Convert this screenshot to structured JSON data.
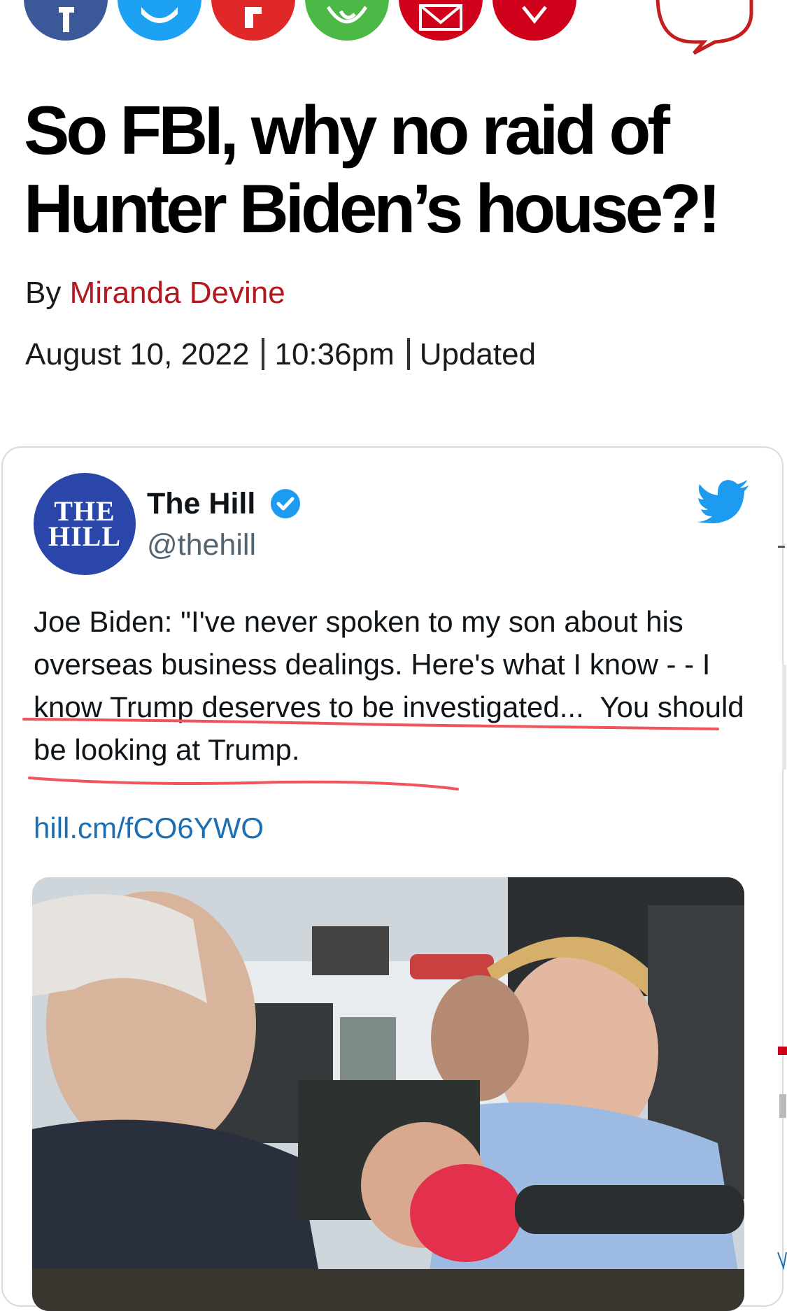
{
  "share_buttons": [
    {
      "icon": "facebook-icon",
      "color": "#3b5998"
    },
    {
      "icon": "twitter-icon",
      "color": "#1da1f2"
    },
    {
      "icon": "flipboard-icon",
      "color": "#e12828"
    },
    {
      "icon": "whatsapp-icon",
      "color": "#25d366"
    },
    {
      "icon": "email-icon",
      "color": "#d0021b"
    },
    {
      "icon": "link-icon",
      "color": "#d0021b"
    },
    {
      "icon": "comment-icon",
      "color": "#c41e1e"
    }
  ],
  "article": {
    "headline": "So FBI, why no raid of Hunter Biden’s house?!",
    "byline_prefix": "By",
    "author": "Miranda Devine",
    "date": "August 10, 2022",
    "time": "10:36pm",
    "updated_label": "Updated"
  },
  "tweet": {
    "account_name": "The Hill",
    "handle": "@thehill",
    "avatar_line1": "THE",
    "avatar_line2": "HILL",
    "text_part1": "Joe Biden: \"I've never spoken to my son about his overseas business dealings. Here's what I know - - I know Trump deserves to be investigated...",
    "text_part2": "You should be looking at Trump.",
    "link": "hill.cm/fCO6YWO",
    "accent_color": "#1d9bf0",
    "annotation_color": "#f2545b"
  }
}
